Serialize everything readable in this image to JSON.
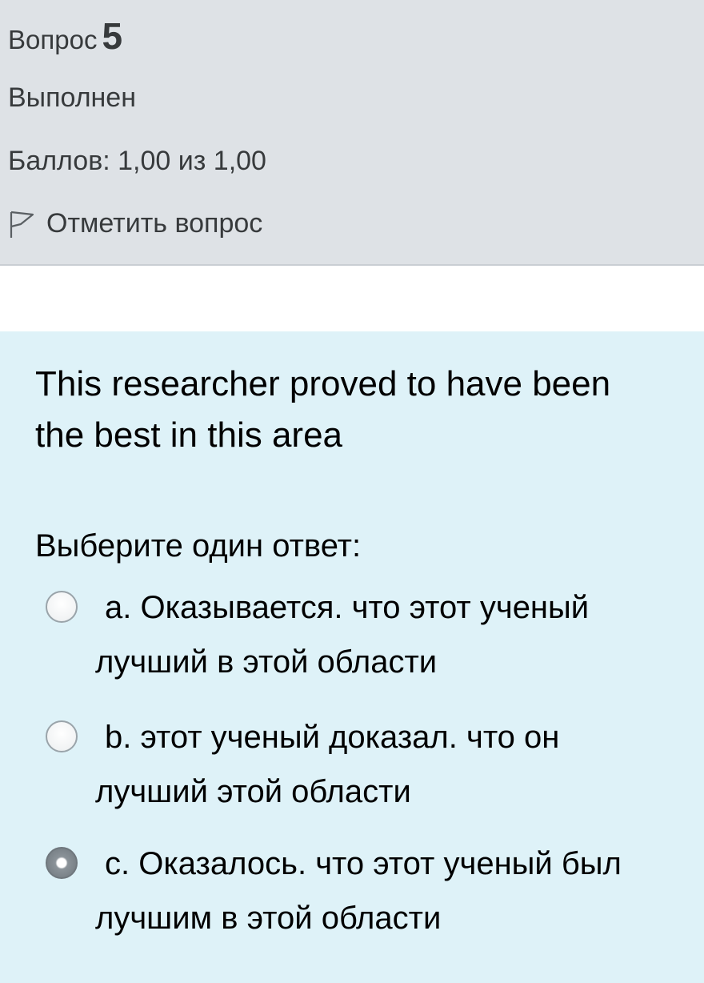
{
  "info": {
    "question_label": "Вопрос",
    "question_number": "5",
    "state": "Выполнен",
    "grade": "Баллов: 1,00 из 1,00",
    "flag_label": "Отметить вопрос"
  },
  "question": {
    "text": "This researcher proved to have been the best in this area",
    "prompt": "Выберите один ответ:",
    "answers": [
      {
        "label": "a. Оказывается. что этот ученый лучший в этой области",
        "selected": false
      },
      {
        "label": "b. этот ученый доказал. что он лучший  этой области",
        "selected": false
      },
      {
        "label": "c. Оказалось. что этот ученый был лучшим в этой области",
        "selected": true
      }
    ]
  }
}
